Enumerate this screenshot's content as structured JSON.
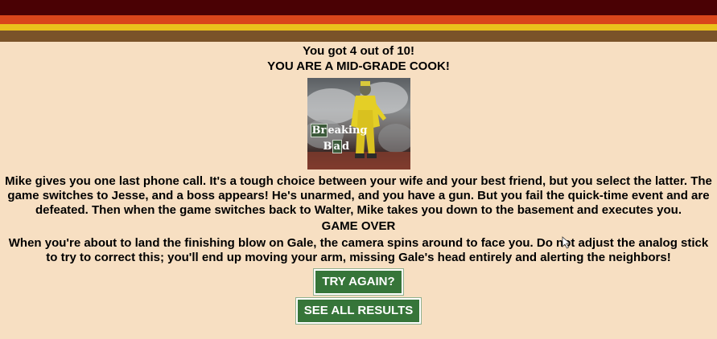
{
  "colors": {
    "stripe_dark": "#4a0104",
    "stripe_orange": "#d9461b",
    "stripe_yellow": "#eac21c",
    "stripe_brown": "#7a5329",
    "background": "#f7dfc2",
    "button": "#367539"
  },
  "result": {
    "score_text": "You got 4 out of 10!",
    "rank_text": "YOU ARE A MID-GRADE COOK!"
  },
  "poster": {
    "logo_line1_el": "Br",
    "logo_line1_rest": "eaking",
    "logo_line2_pre": "B",
    "logo_line2_el": "a",
    "logo_line2_rest": "d"
  },
  "story": "Mike gives you one last phone call. It's a tough choice between your wife and your best friend, but you select the latter. The game switches to Jesse, and a boss appears! He's unarmed, and you have a gun. But you fail the quick-time event and are defeated. Then when the game switches back to Walter, Mike takes you down to the basement and executes you.",
  "game_over": "GAME OVER",
  "tip": "When you're about to land the finishing blow on Gale, the camera spins around to face you. Do not adjust the analog stick to try to correct this; you'll end up moving your arm, missing Gale's head entirely and alerting the neighbors!",
  "buttons": {
    "try_again": "TRY AGAIN?",
    "see_all": "SEE ALL RESULTS"
  }
}
